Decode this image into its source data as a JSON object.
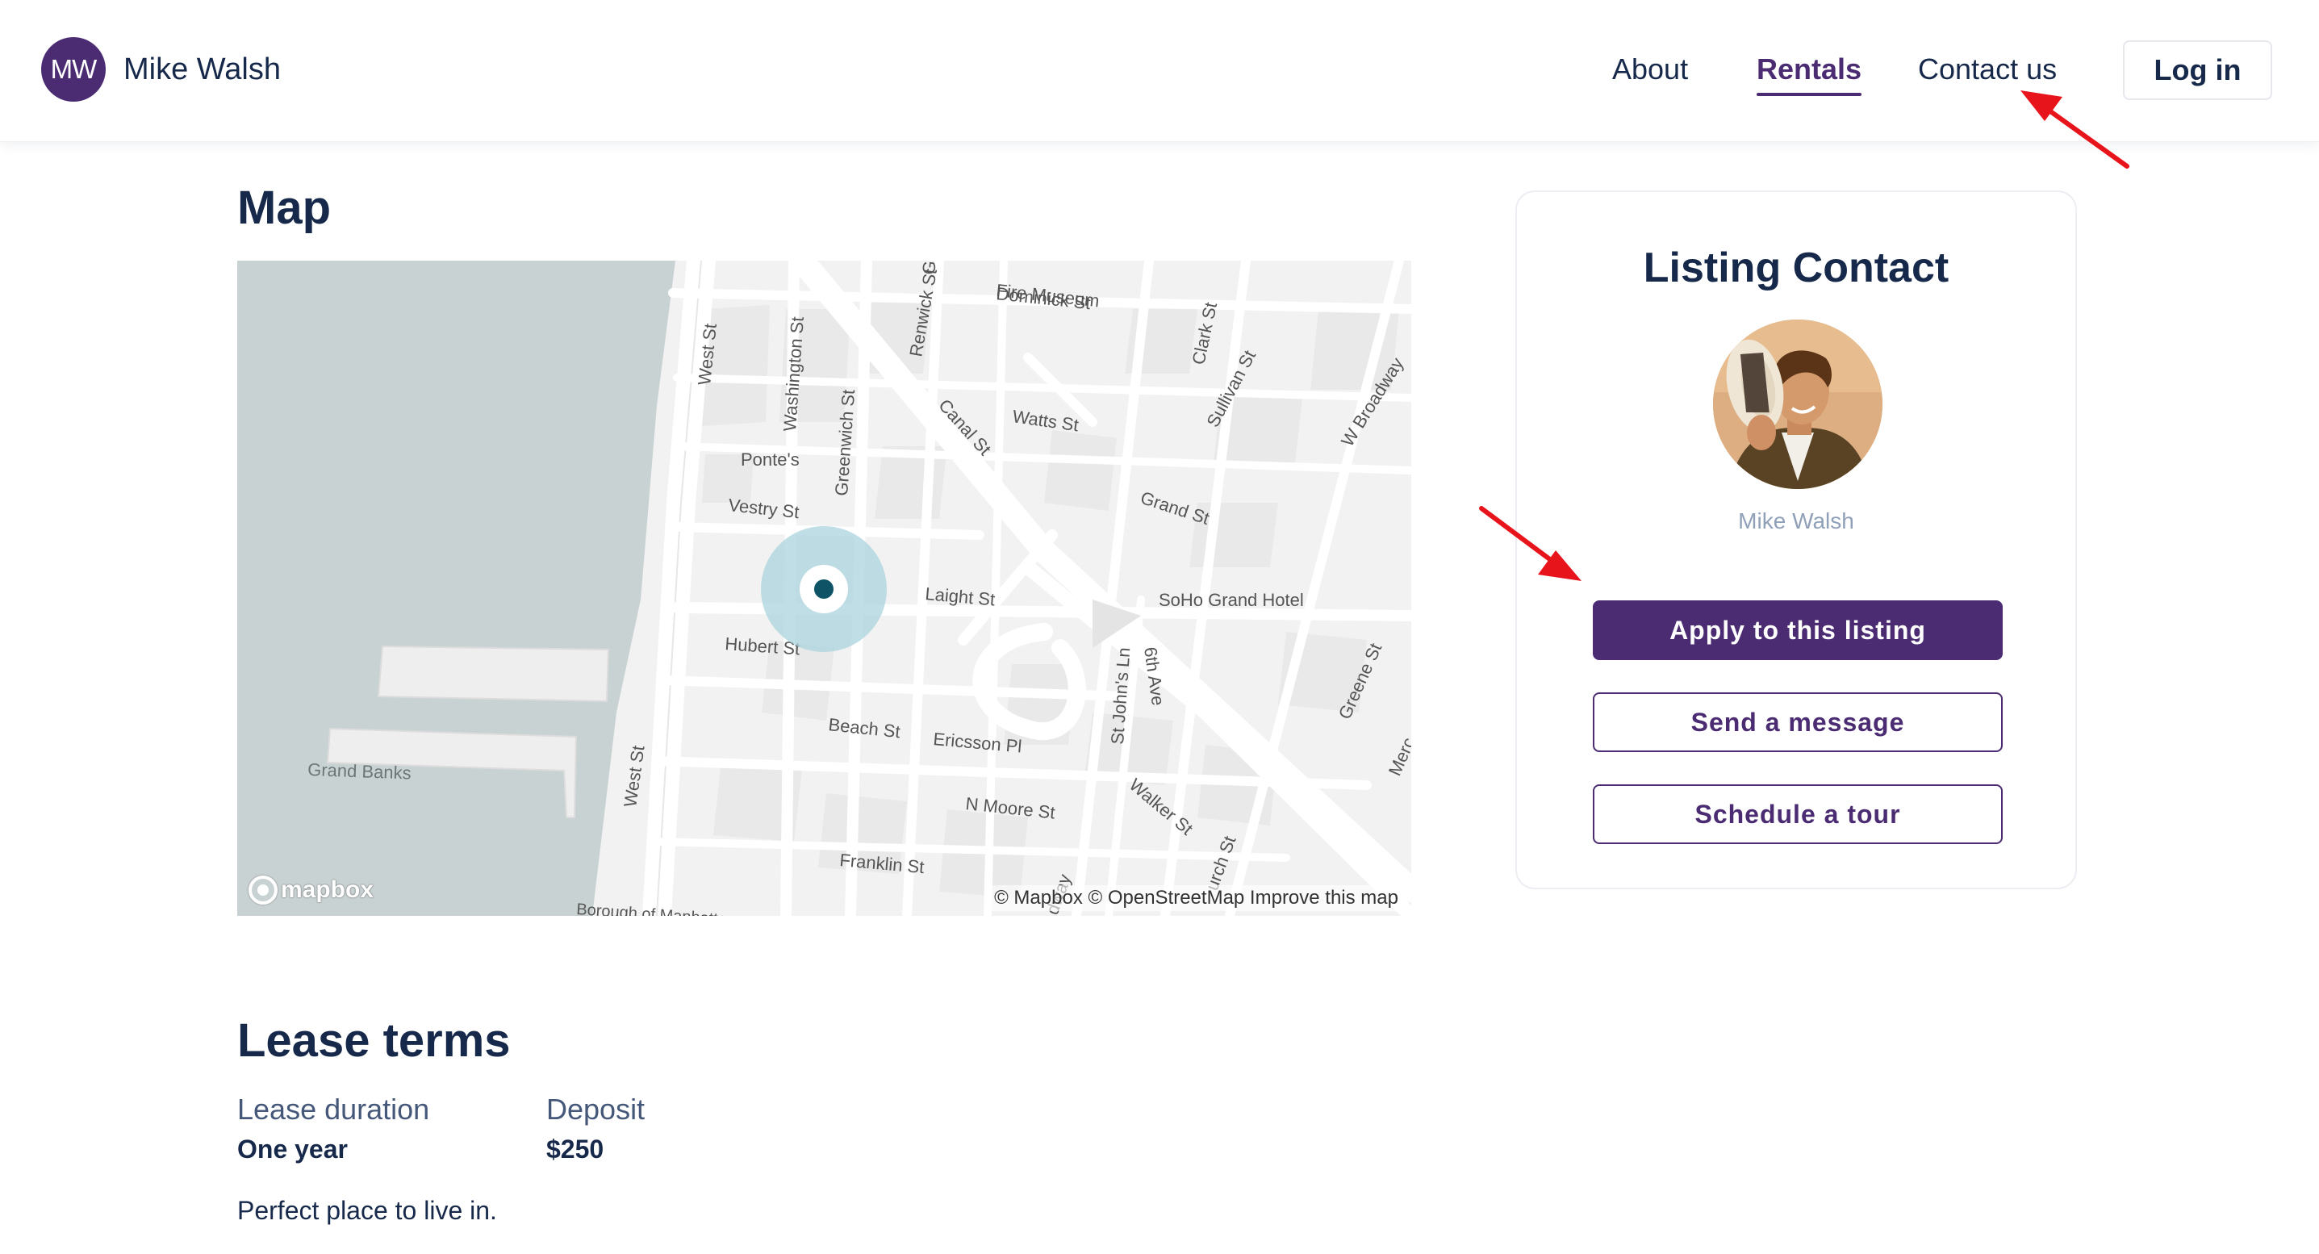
{
  "header": {
    "avatar_initials": "MW",
    "brand_name": "Mike Walsh",
    "nav": {
      "about": "About",
      "rentals": "Rentals",
      "contact": "Contact us"
    },
    "login_label": "Log in"
  },
  "map_section": {
    "title": "Map",
    "streets": {
      "dominick": "Dominick St",
      "west_top": "West St",
      "washington": "Washington St",
      "greenwich": "Greenwich St",
      "renwick": "Renwick St",
      "canal": "Canal St",
      "watts": "Watts St",
      "clark": "Clark St",
      "sullivan": "Sullivan St",
      "broadway": "W Broadway",
      "grand": "Grand St",
      "vestry": "Vestry St",
      "laight": "Laight St",
      "hubert": "Hubert St",
      "beach": "Beach St",
      "ericsson": "Ericsson Pl",
      "stjohns": "St John's Ln",
      "sixth": "6th Ave",
      "nmoore": "N Moore St",
      "walker": "Walker St",
      "church": "urch St",
      "franklin": "Franklin St",
      "west_bottom": "West St",
      "greene": "Greene St",
      "merc": "Merc",
      "way": "dway",
      "fire": "Fire Museum",
      "g": "G",
      "borough": "Borough of Manhattan"
    },
    "places": {
      "pontes": "Ponte's",
      "soho_hotel": "SoHo Grand Hotel",
      "grand_banks": "Grand Banks"
    },
    "attribution": "© Mapbox © OpenStreetMap Improve this map",
    "logo_text": "mapbox",
    "colors": {
      "water": "#c9d2d3",
      "land": "#f2f2f2",
      "road": "#ffffff",
      "pin_halo": "#a9d3dd",
      "pin_dot": "#0e5366"
    }
  },
  "contact_card": {
    "title": "Listing Contact",
    "name": "Mike Walsh",
    "apply_label": "Apply to this listing",
    "message_label": "Send a message",
    "tour_label": "Schedule a tour"
  },
  "lease": {
    "title": "Lease terms",
    "duration_label": "Lease duration",
    "duration_value": "One year",
    "deposit_label": "Deposit",
    "deposit_value": "$250",
    "description": "Perfect place to live in."
  },
  "colors": {
    "brand": "#4b2c73",
    "text": "#17294a",
    "annotation_arrow": "#e8141b"
  }
}
